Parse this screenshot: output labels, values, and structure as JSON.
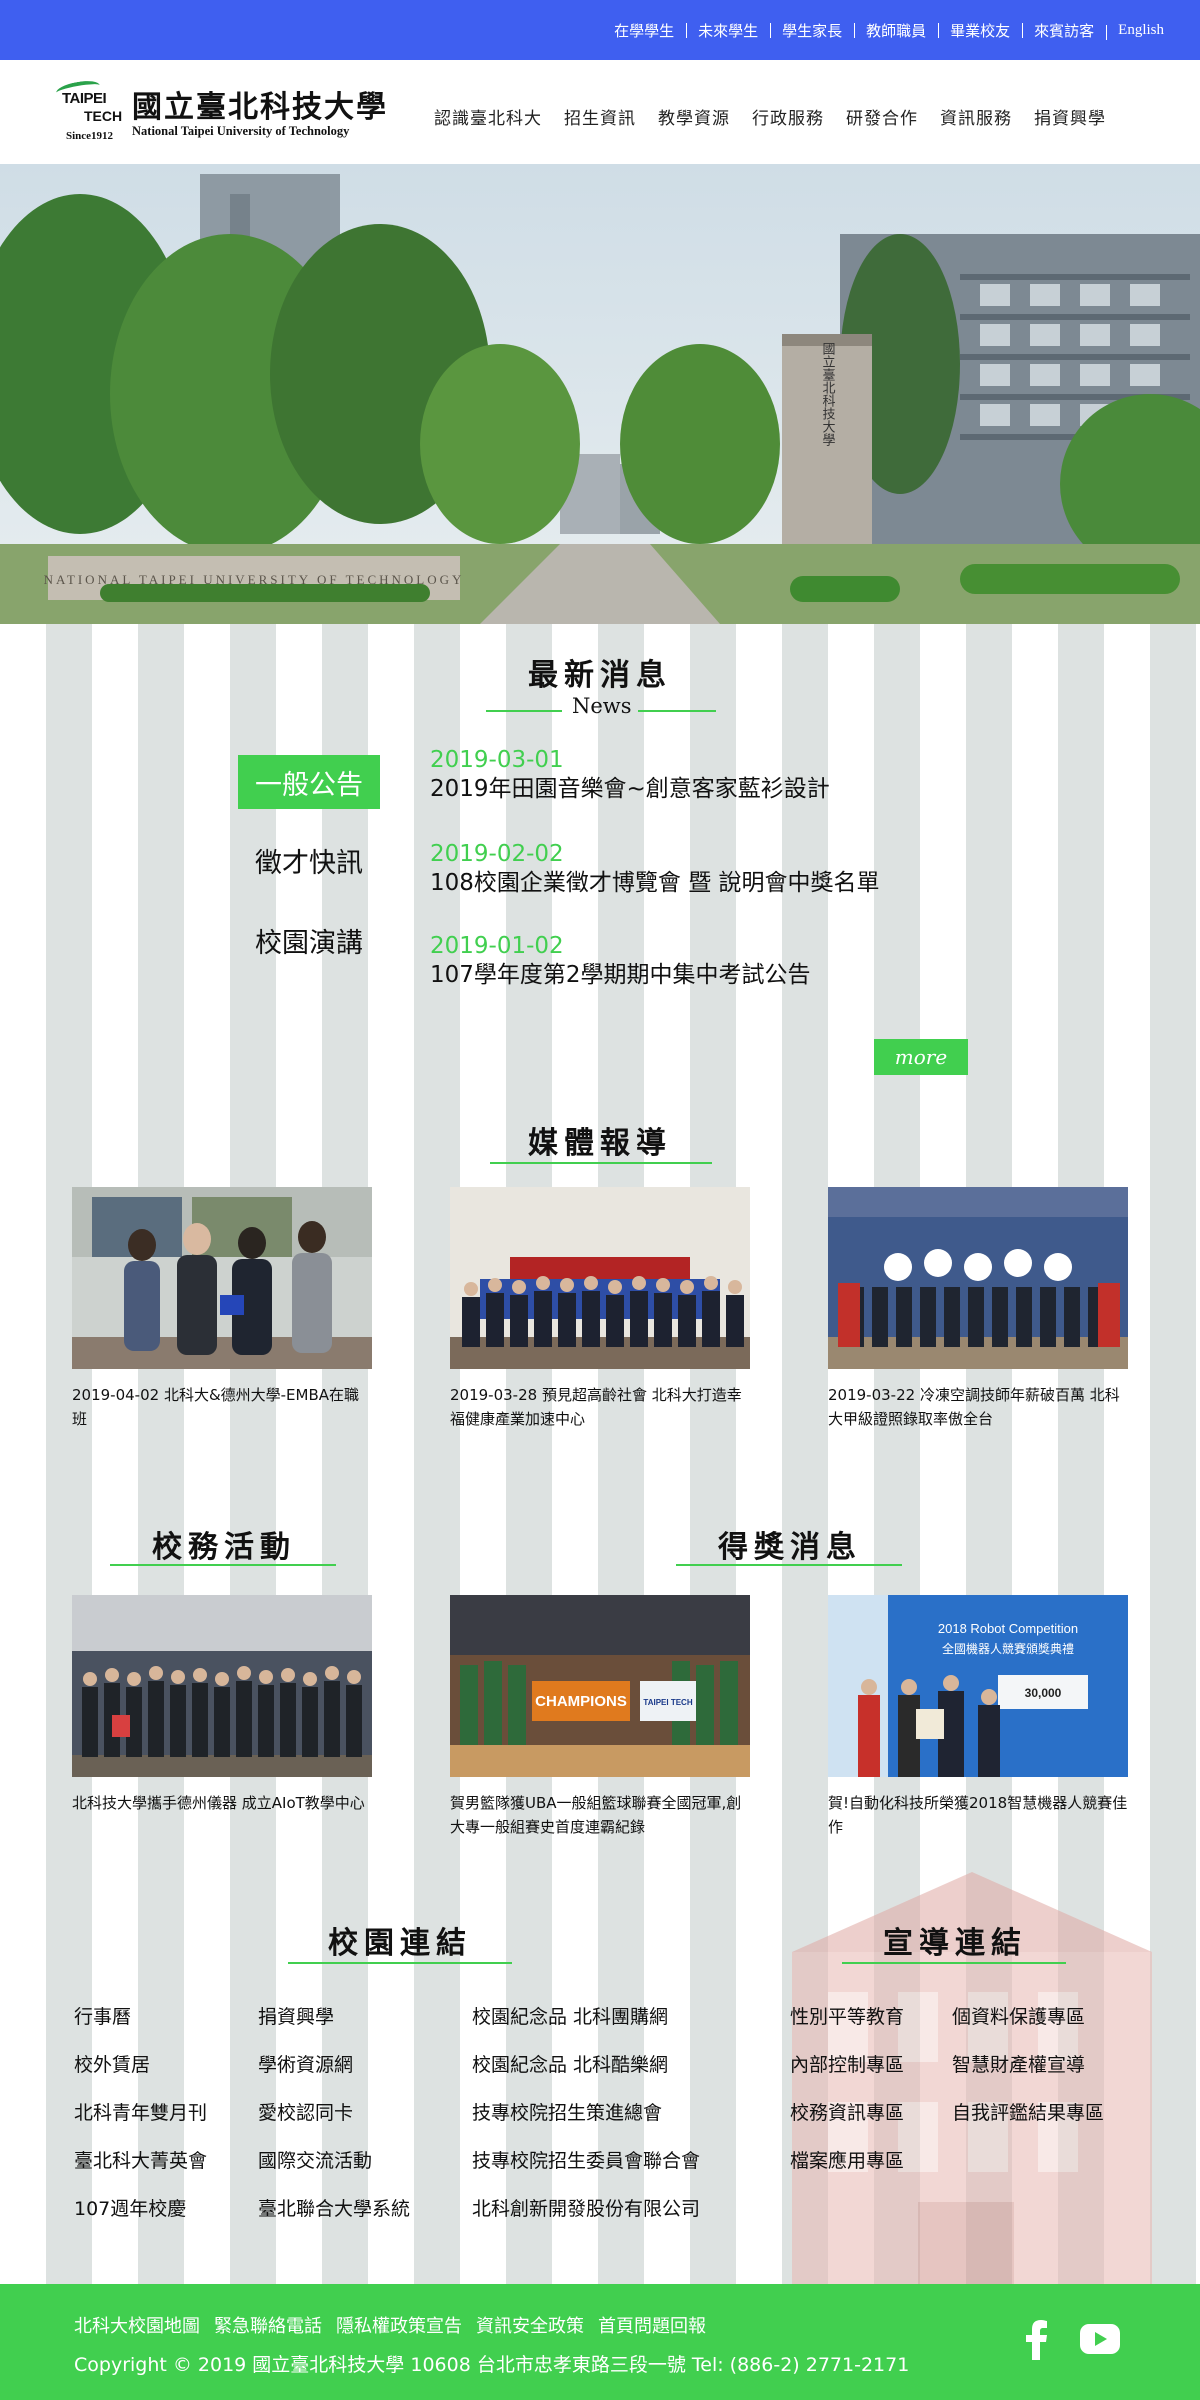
{
  "topbar": {
    "links": [
      "在學學生",
      "未來學生",
      "學生家長",
      "教師職員",
      "畢業校友",
      "來賓訪客",
      "English"
    ]
  },
  "logo": {
    "mark_top": "TAIPEI",
    "mark_bottom": "TECH",
    "since": "Since1912",
    "name_zh": "國立臺北科技大學",
    "name_en": "National Taipei University of Technology"
  },
  "mainnav": [
    "認識臺北科大",
    "招生資訊",
    "教學資源",
    "行政服務",
    "研發合作",
    "資訊服務",
    "捐資興學"
  ],
  "hero": {
    "wall_text": "NATIONAL TAIPEI UNIVERSITY OF TECHNOLOGY",
    "pillar_text": "國立臺北科技大學"
  },
  "news": {
    "title": "最新消息",
    "subtitle": "News",
    "tabs": [
      "一般公告",
      "徵才快訊",
      "校園演講"
    ],
    "active_tab": 0,
    "items": [
      {
        "date": "2019-03-01",
        "text": "2019年田園音樂會~創意客家藍衫設計"
      },
      {
        "date": "2019-02-02",
        "text": "108校園企業徵才博覽會 暨 說明會中獎名單"
      },
      {
        "date": "2019-01-02",
        "text": "107學年度第2學期期中集中考試公告"
      }
    ],
    "more_label": "more"
  },
  "media": {
    "title": "媒體報導",
    "cards": [
      {
        "caption": "2019-04-02 北科大&德州大學-EMBA在職班"
      },
      {
        "caption": "2019-03-28 預見超高齡社會 北科大打造幸福健康產業加速中心"
      },
      {
        "caption": "2019-03-22 冷凍空調技師年薪破百萬 北科大甲級證照錄取率傲全台"
      }
    ]
  },
  "activities": {
    "title": "校務活動",
    "cards": [
      {
        "caption": "北科技大學攜手德州儀器 成立AIoT教學中心"
      }
    ]
  },
  "awards": {
    "title": "得獎消息",
    "cards": [
      {
        "caption": "賀男籃隊獲UBA一般組籃球聯賽全國冠軍,創大專一般組賽史首度連霸紀錄",
        "banner": "CHAMPIONS",
        "flag": "TAIPEI TECH"
      },
      {
        "caption": "賀!自動化科技所榮獲2018智慧機器人競賽佳作",
        "banner": "2018 Robot Competition",
        "banner2": "全國機器人競賽頒獎典禮",
        "check": "30,000"
      }
    ]
  },
  "campus_links": {
    "title": "校園連結",
    "col1": [
      "行事曆",
      "校外賃居",
      "北科青年雙月刊",
      "臺北科大菁英會",
      "107週年校慶"
    ],
    "col2": [
      "捐資興學",
      "學術資源網",
      "愛校認同卡",
      "國際交流活動",
      "臺北聯合大學系統"
    ],
    "col3": [
      "校園紀念品 北科團購網",
      "校園紀念品 北科酷樂網",
      "技專校院招生策進總會",
      "技專校院招生委員會聯合會",
      "北科創新開發股份有限公司"
    ]
  },
  "promo_links": {
    "title": "宣導連結",
    "col1": [
      "性別平等教育",
      "內部控制專區",
      "校務資訊專區",
      "檔案應用專區"
    ],
    "col2": [
      "個資料保護專區",
      "智慧財產權宣導",
      "自我評鑑結果專區"
    ]
  },
  "footer": {
    "links": [
      "北科大校園地圖",
      "緊急聯絡電話",
      "隱私權政策宣告",
      "資訊安全政策",
      "首頁問題回報"
    ],
    "copyright": "Copyright © 2019 國立臺北科技大學 10608 台北市忠孝東路三段一號 Tel: (886-2) 2771-2171",
    "social": [
      "facebook-icon",
      "youtube-icon"
    ]
  },
  "colors": {
    "topbar": "#3f5ff0",
    "accent": "#41cf4f",
    "stripe": "#dde2e1"
  }
}
